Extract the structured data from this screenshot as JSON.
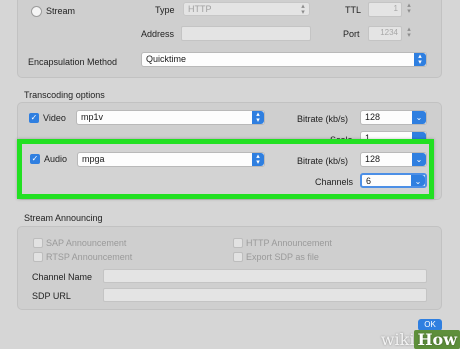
{
  "stream": {
    "label": "Stream",
    "type_label": "Type",
    "type_value": "HTTP",
    "ttl_label": "TTL",
    "ttl_value": "1",
    "address_label": "Address",
    "port_label": "Port",
    "port_value": "1234",
    "encapsulation_label": "Encapsulation Method",
    "encapsulation_value": "Quicktime"
  },
  "transcoding": {
    "section_title": "Transcoding options",
    "video_label": "Video",
    "video_codec": "mp1v",
    "video_bitrate_label": "Bitrate (kb/s)",
    "video_bitrate_value": "128",
    "scale_label": "Scale",
    "scale_value": "1",
    "audio_label": "Audio",
    "audio_codec": "mpga",
    "audio_bitrate_label": "Bitrate (kb/s)",
    "audio_bitrate_value": "128",
    "channels_label": "Channels",
    "channels_value": "6"
  },
  "announcing": {
    "section_title": "Stream Announcing",
    "sap": "SAP Announcement",
    "rtsp": "RTSP Announcement",
    "http": "HTTP Announcement",
    "export_sdp": "Export SDP as file",
    "channel_name_label": "Channel Name",
    "sdp_url_label": "SDP URL"
  },
  "ok_label": "OK",
  "watermark": {
    "part1": "wiki",
    "part2": "How"
  },
  "colors": {
    "accent": "#2f7fe0",
    "highlight": "#22e022",
    "background": "#d6d6d6"
  },
  "icons": {
    "stepper": "up-down-arrows-icon",
    "check": "checkmark-icon",
    "dropdown": "chevron-down-icon"
  }
}
